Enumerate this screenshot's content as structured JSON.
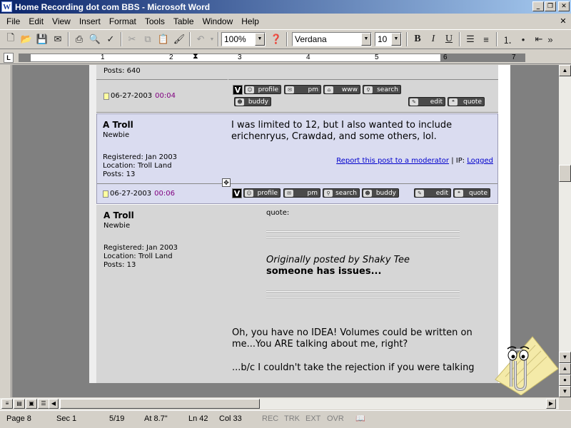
{
  "window": {
    "title": "Home Recording dot com BBS - Microsoft Word",
    "app_icon": "W"
  },
  "menu": [
    "File",
    "Edit",
    "View",
    "Insert",
    "Format",
    "Tools",
    "Table",
    "Window",
    "Help"
  ],
  "toolbar": {
    "zoom": "100%",
    "font": "Verdana",
    "size": "10",
    "bold": "B",
    "italic": "I",
    "underline": "U"
  },
  "ruler": {
    "numbers": [
      "1",
      "2",
      "3",
      "4",
      "5",
      "6",
      "7"
    ]
  },
  "posts": [
    {
      "posts_label": "Posts: 640",
      "date": "06-27-2003",
      "time": "00:04",
      "buttons": [
        "profile",
        "pm",
        "www",
        "search",
        "buddy",
        "edit",
        "quote"
      ]
    },
    {
      "username": "A Troll",
      "rank": "Newbie",
      "registered": "Registered: Jan 2003",
      "location": "Location: Troll Land",
      "posts_label": "Posts: 13",
      "body": "I was limited to 12, but I also wanted to include erichenryus, Crawdad, and some others, lol.",
      "report_link": "Report this post to a moderator",
      "ip_label": " | IP: ",
      "ip_link": "Logged",
      "date": "06-27-2003",
      "time": "00:06",
      "buttons": [
        "profile",
        "pm",
        "search",
        "buddy",
        "edit",
        "quote"
      ]
    },
    {
      "username": "A Troll",
      "rank": "Newbie",
      "registered": "Registered: Jan 2003",
      "location": "Location: Troll Land",
      "posts_label": "Posts: 13",
      "quote_label": "quote:",
      "quote_attrib": "Originally posted by Shaky Tee",
      "quote_text": "someone has issues...",
      "body1": "Oh, you have no IDEA! Volumes could be written on me...You ARE talking about me, right?",
      "body2": "...b/c I couldn't take the rejection if you were talking"
    }
  ],
  "status": {
    "page": "Page 8",
    "sec": "Sec 1",
    "pages": "5/19",
    "at": "At 8.7\"",
    "ln": "Ln 42",
    "col": "Col 33",
    "rec": "REC",
    "trk": "TRK",
    "ext": "EXT",
    "ovr": "OVR"
  }
}
